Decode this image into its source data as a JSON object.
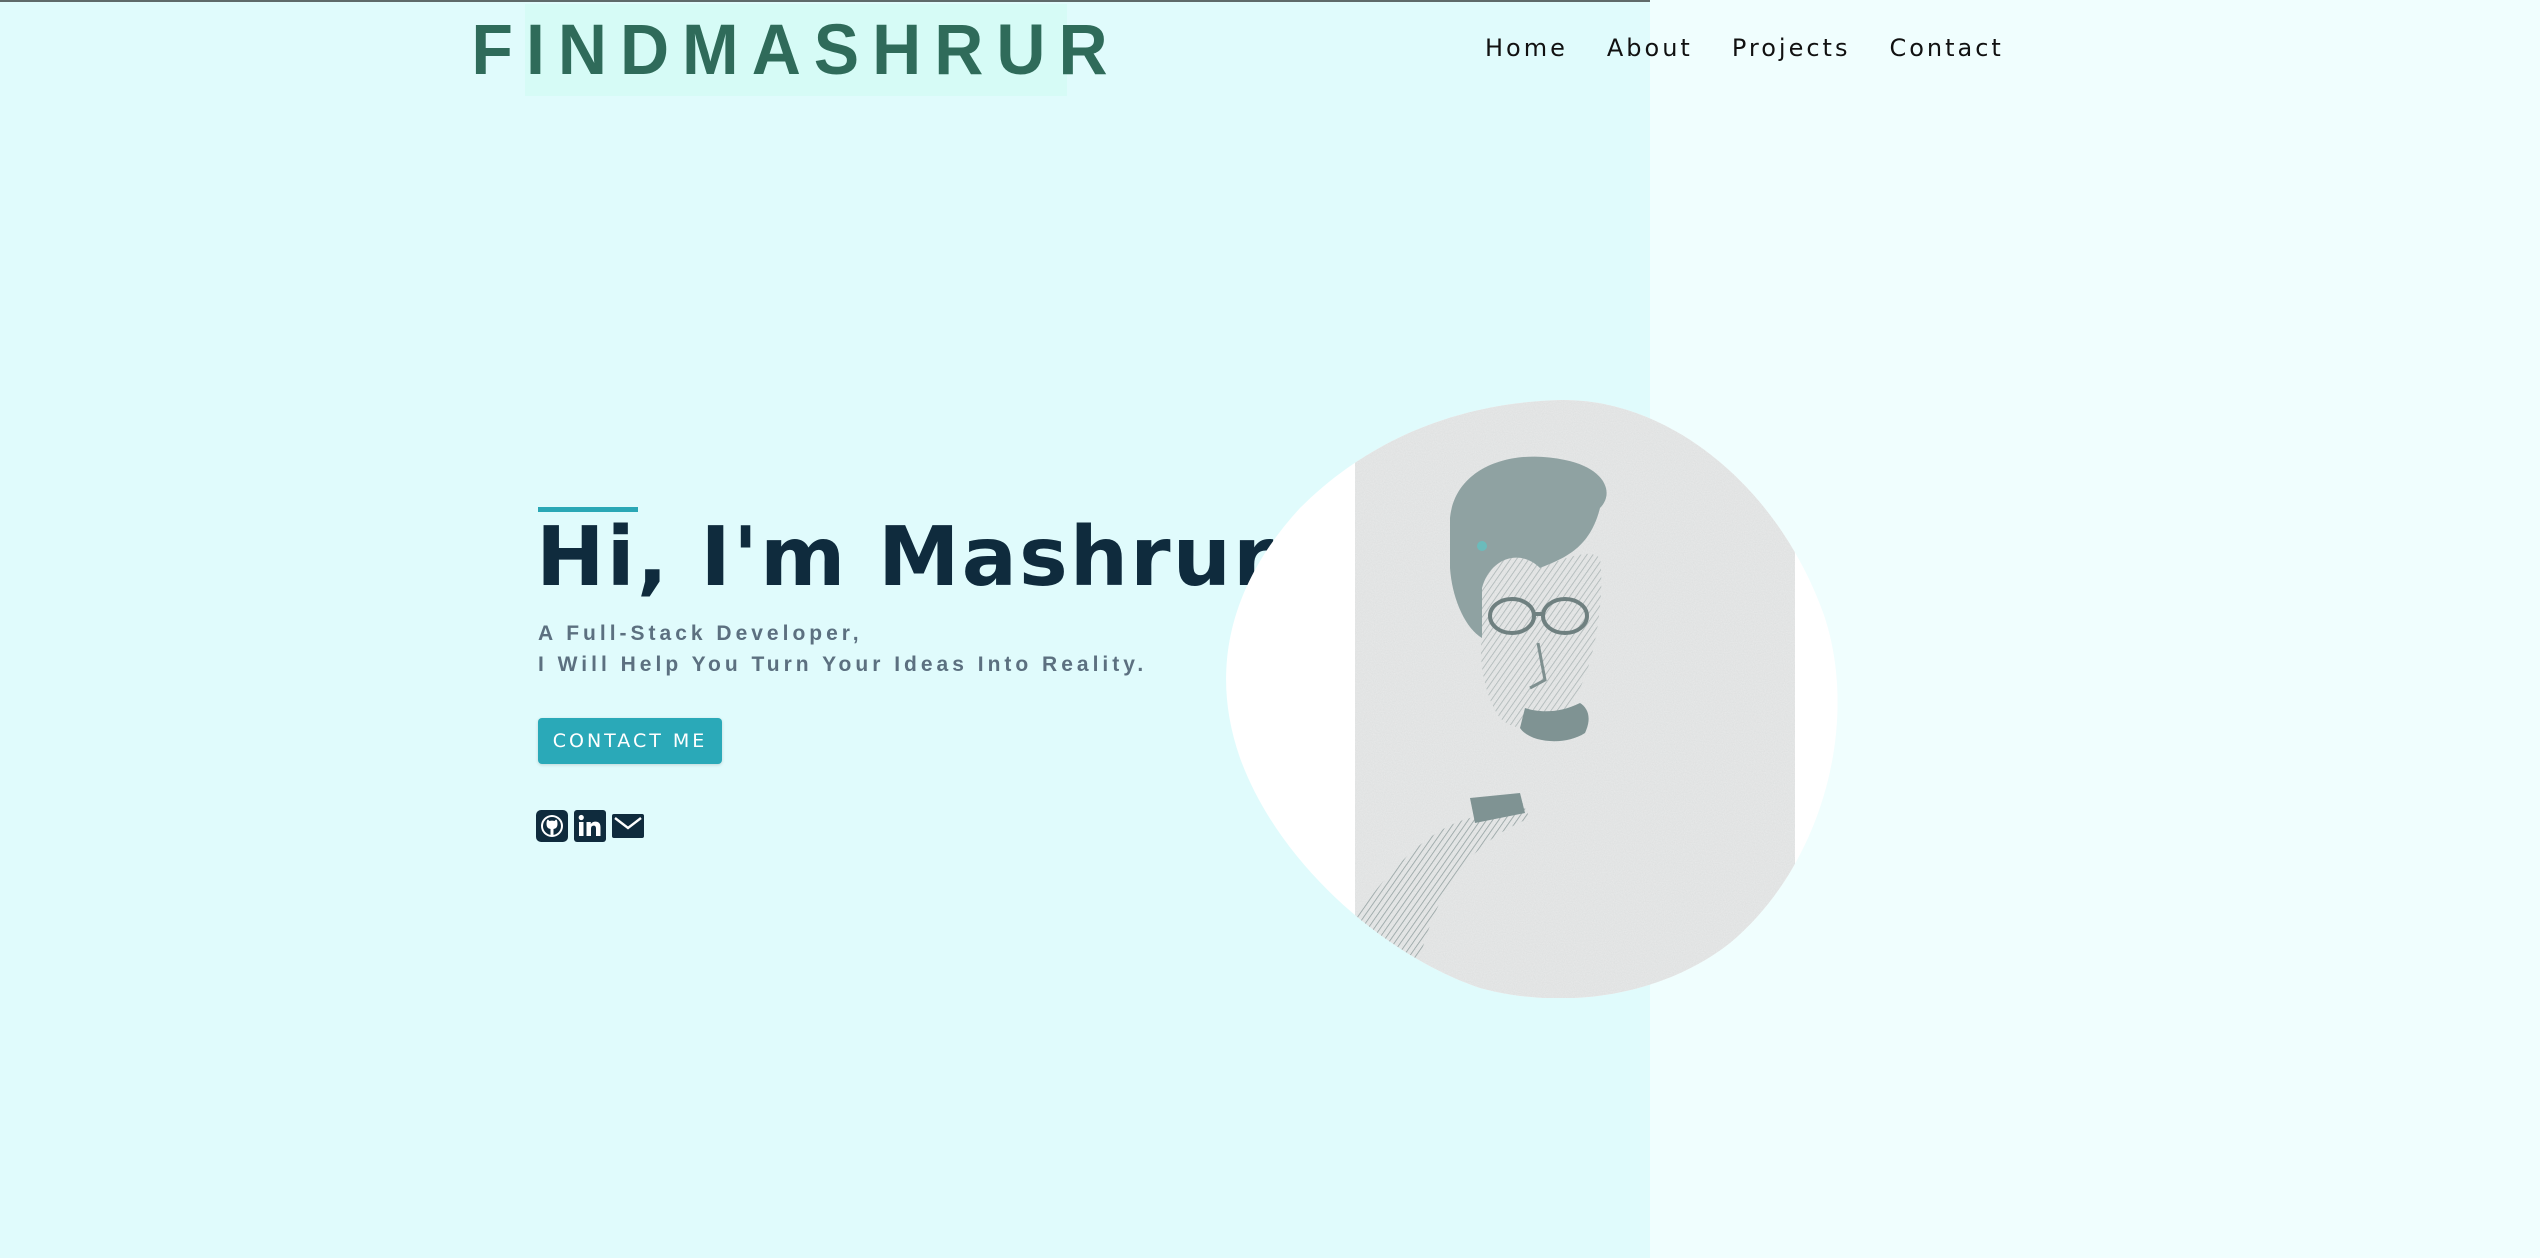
{
  "header": {
    "logo_text": "FINDMASHRUR",
    "nav": [
      {
        "label": "Home"
      },
      {
        "label": "About"
      },
      {
        "label": "Projects"
      },
      {
        "label": "Contact"
      }
    ]
  },
  "hero": {
    "title": "Hi, I'm Mashrur",
    "subtitle_line1": "A Full-Stack Developer,",
    "subtitle_line2": "I Will Help You Turn Your Ideas Into Reality.",
    "cta_label": "CONTACT ME",
    "socials": [
      {
        "icon": "github-icon"
      },
      {
        "icon": "linkedin-icon"
      },
      {
        "icon": "email-icon"
      }
    ]
  },
  "colors": {
    "background": "#e0fbfc",
    "accent": "#2aa9b8",
    "heading": "#0f2b3d",
    "logo": "#2f6b5a"
  }
}
